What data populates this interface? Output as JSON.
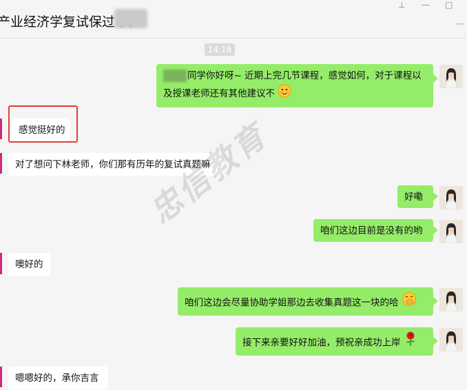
{
  "window": {
    "title": "产业经济学复试保过-关",
    "pin_glyph": "⊥",
    "minimize_glyph": "—",
    "maximize_glyph": "□",
    "more_glyph": "···"
  },
  "timestamp": "14:18",
  "watermark": "忠信教育",
  "messages": [
    {
      "side": "right",
      "text": "同学你好呀~  近期上完几节课程，感觉如何，对于课程以及授课老师还有其他建议不",
      "emoji": "smiling-face-emoji"
    },
    {
      "side": "left",
      "text": "感觉挺好的",
      "highlighted": true
    },
    {
      "side": "left",
      "text": "对了想问下林老师，你们那有历年的复试真题嘛"
    },
    {
      "side": "right",
      "text": "好嘞"
    },
    {
      "side": "right",
      "text": "咱们这边目前是没有的哟"
    },
    {
      "side": "left",
      "text": "噢好的"
    },
    {
      "side": "right",
      "text": "咱们这边会尽量协助学姐那边去收集真题这一块的哈",
      "emoji": "hand-over-mouth-emoji"
    },
    {
      "side": "right",
      "text": "接下来亲要好好加油，预祝亲成功上岸",
      "emoji": "rose-emoji"
    },
    {
      "side": "left",
      "text": "嗯嗯好的，承你吉言"
    }
  ]
}
